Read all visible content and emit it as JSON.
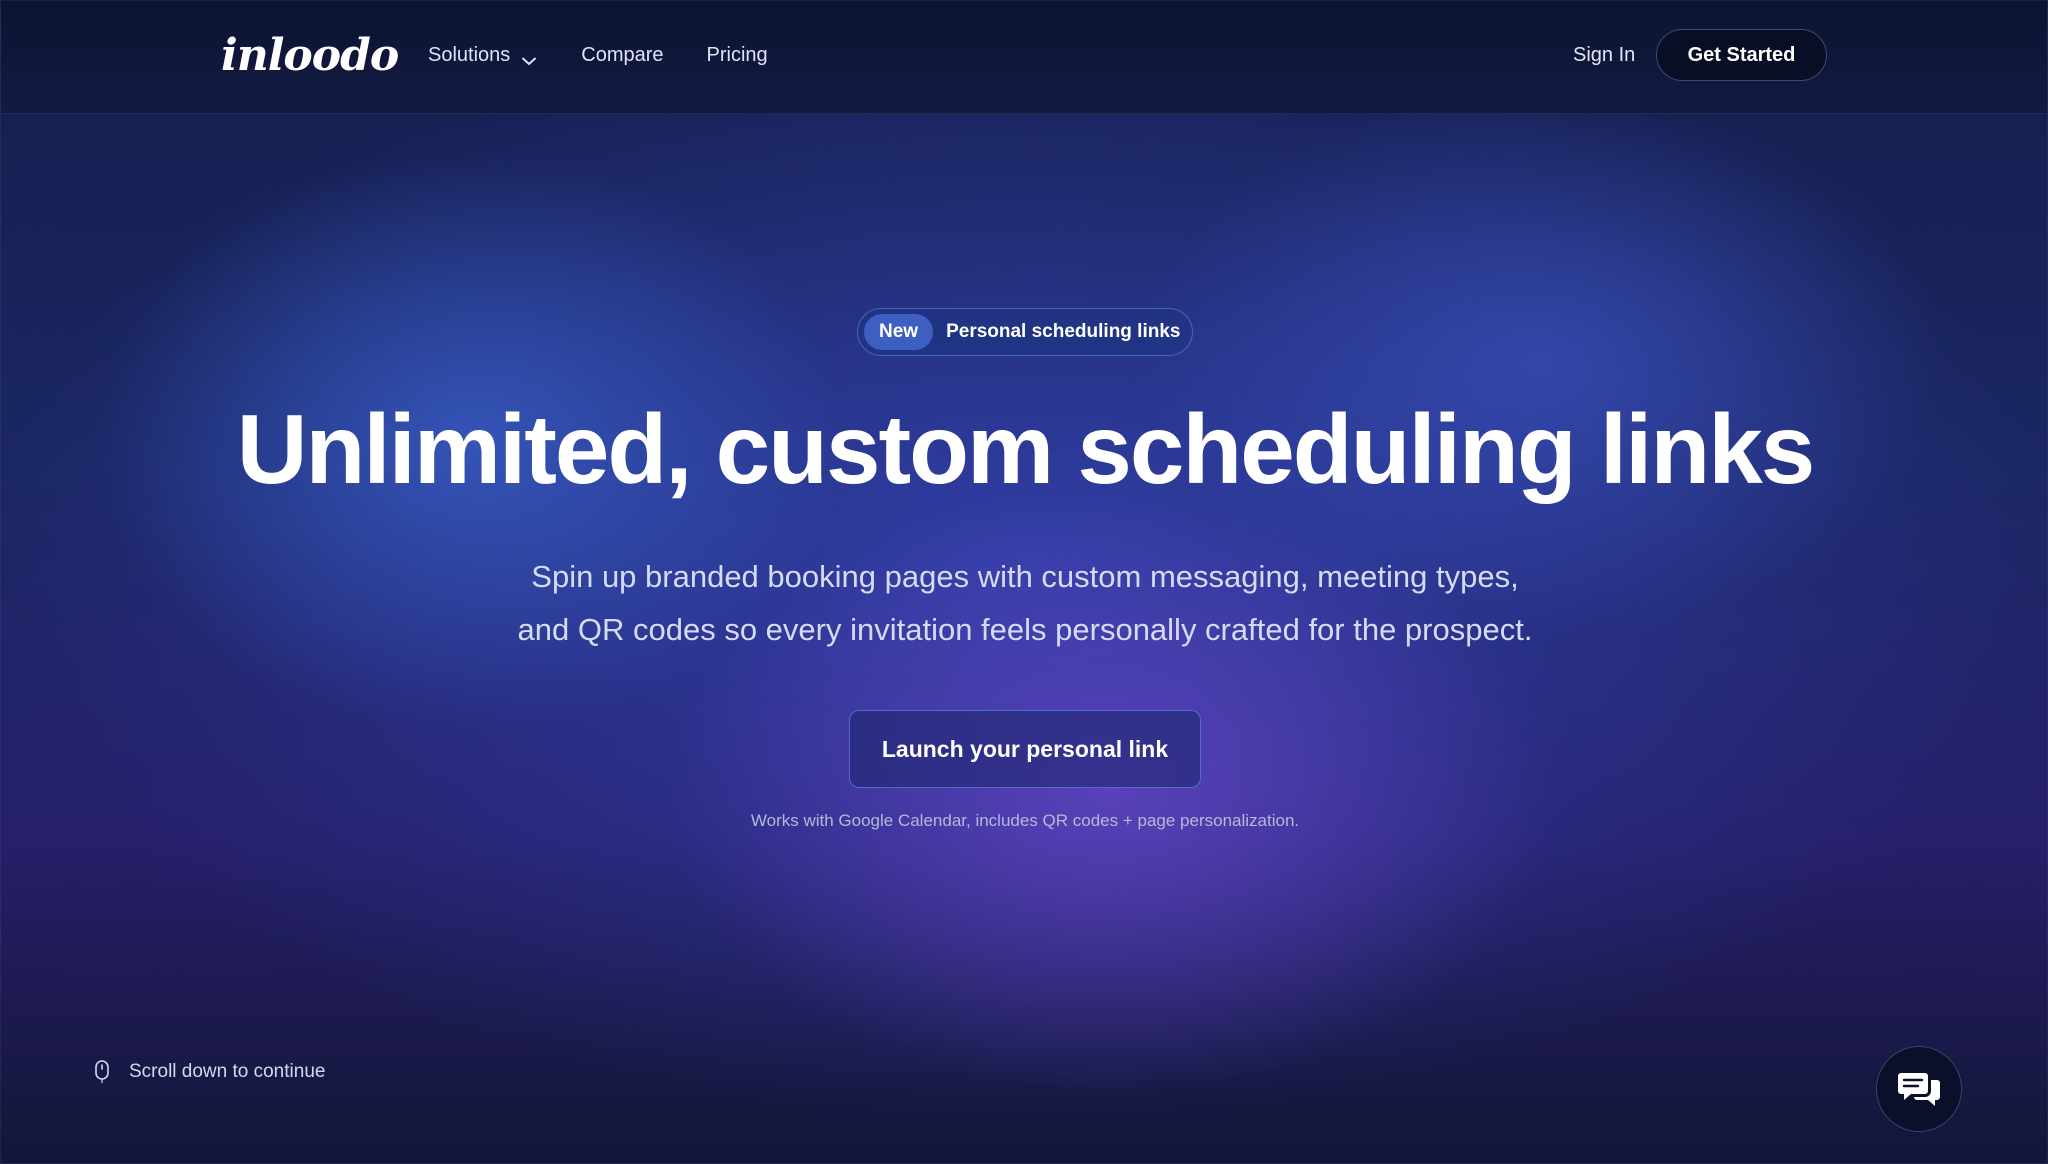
{
  "brand": {
    "logo_text": "inloodo"
  },
  "nav": {
    "items": [
      {
        "label": "Solutions",
        "has_dropdown": true
      },
      {
        "label": "Compare"
      },
      {
        "label": "Pricing"
      }
    ],
    "sign_in": "Sign In",
    "get_started": "Get Started"
  },
  "hero": {
    "badge_tag": "New",
    "badge_text": "Personal scheduling links",
    "headline": "Unlimited, custom scheduling links",
    "subtext_line1": "Spin up branded booking pages with custom messaging, meeting types,",
    "subtext_line2": "and QR codes so every invitation feels personally crafted for the prospect.",
    "cta_label": "Launch your personal link",
    "note": "Works with Google Calendar, includes QR codes + page personalization."
  },
  "footer": {
    "scroll_hint": "Scroll down to continue"
  },
  "icons": {
    "dropdown": "chevron-down-icon",
    "scroll": "mouse-icon",
    "chat": "chat-bubbles-icon"
  },
  "colors": {
    "background_top": "#151e4c",
    "background_glow_blue": "#3a62cd",
    "background_glow_purple": "#6c48cd",
    "cta_border": "#5f7deb",
    "text_primary": "#ffffff"
  }
}
